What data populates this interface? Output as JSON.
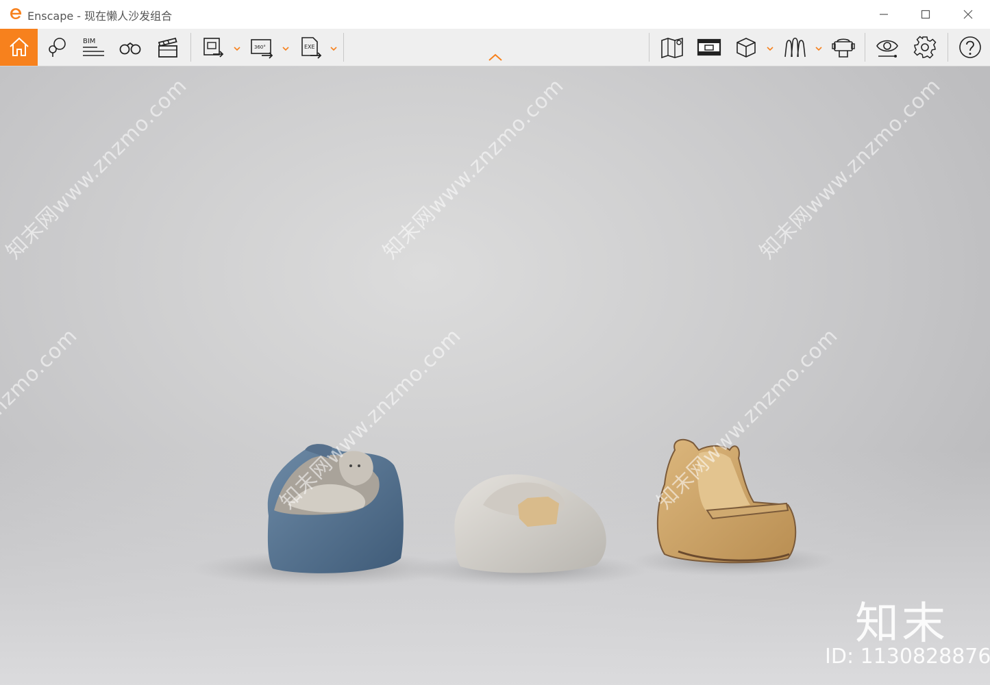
{
  "window": {
    "title": "Enscape - 现在懒人沙发组合",
    "app_logo": "enscape-logo-icon",
    "controls": [
      "minimize-icon",
      "maximize-icon",
      "close-icon"
    ]
  },
  "toolbar": {
    "accent_color": "#f7811d",
    "left_items": [
      {
        "name": "home",
        "icon": "home-icon",
        "active": true
      },
      {
        "name": "views",
        "icon": "map-pin-icon"
      },
      {
        "name": "bim",
        "icon": "bim-icon",
        "label": "BIM"
      },
      {
        "name": "binoculars",
        "icon": "binoculars-icon"
      },
      {
        "name": "video-editor",
        "icon": "clapperboard-icon"
      },
      {
        "name": "screenshot-export",
        "icon": "export-image-icon",
        "has_dropdown": true
      },
      {
        "name": "panorama-export",
        "icon": "export-360-icon",
        "label": "360°",
        "has_dropdown": true
      },
      {
        "name": "exe-export",
        "icon": "export-exe-icon",
        "label": "EXE",
        "has_dropdown": true
      }
    ],
    "right_items": [
      {
        "name": "map",
        "icon": "map-icon"
      },
      {
        "name": "asset-library",
        "icon": "asset-library-icon"
      },
      {
        "name": "section-box",
        "icon": "cube-icon",
        "has_dropdown": true
      },
      {
        "name": "materials",
        "icon": "material-icon",
        "has_dropdown": true
      },
      {
        "name": "vr",
        "icon": "vr-headset-icon"
      },
      {
        "name": "visual-settings",
        "icon": "eye-icon"
      },
      {
        "name": "settings",
        "icon": "gear-icon"
      },
      {
        "name": "help",
        "icon": "help-icon"
      }
    ],
    "collapse_icon": "chevron-up-icon"
  },
  "viewport": {
    "watermark_text": "知末网www.znzmo.com",
    "brand_logo": "知末",
    "id_label": "ID: 1130828876",
    "objects": [
      "blue-bean-bag-sofa",
      "white-bean-bag-sofa",
      "tan-bear-sofa"
    ]
  }
}
